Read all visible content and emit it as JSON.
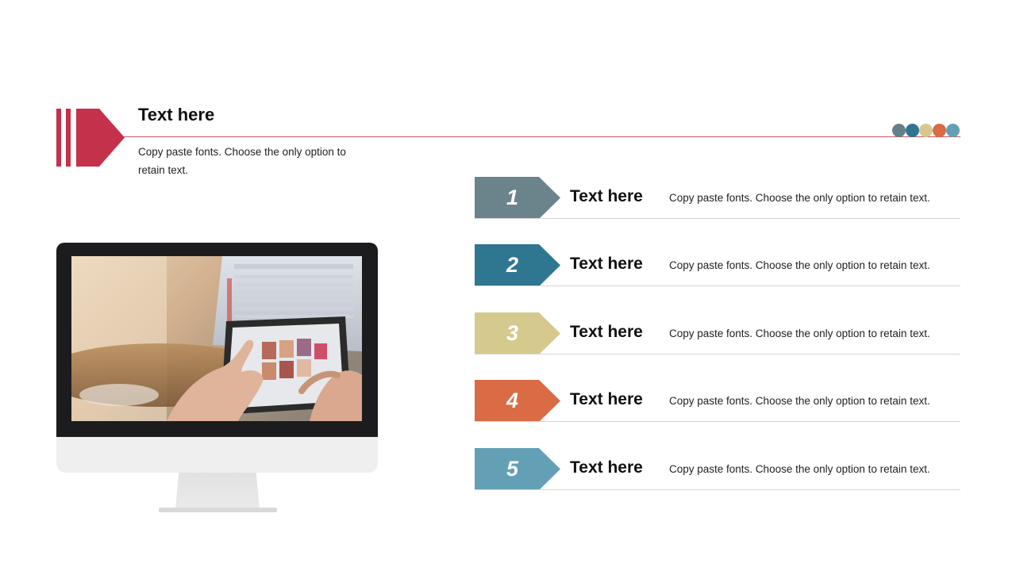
{
  "header": {
    "title": "Text here",
    "description": "Copy paste fonts. Choose the only option to retain text.",
    "accent_color": "#c4314b",
    "icon": "chevron-bars-icon"
  },
  "palette": [
    "#647f87",
    "#2f7690",
    "#d7c98d",
    "#d96b45",
    "#64a0b5"
  ],
  "monitor": {
    "image": "hands-using-tablet-photo"
  },
  "steps": [
    {
      "number": "1",
      "title": "Text here",
      "description": "Copy paste fonts. Choose the only option to retain text.",
      "color": "#6b848c"
    },
    {
      "number": "2",
      "title": "Text here",
      "description": "Copy paste fonts. Choose the only option to retain text.",
      "color": "#2f7690"
    },
    {
      "number": "3",
      "title": "Text here",
      "description": "Copy paste fonts. Choose the only option to retain text.",
      "color": "#d6c98e"
    },
    {
      "number": "4",
      "title": "Text here",
      "description": "Copy paste fonts. Choose the only option to retain text.",
      "color": "#d96b45"
    },
    {
      "number": "5",
      "title": "Text here",
      "description": "Copy paste fonts. Choose the only option to retain text.",
      "color": "#64a0b5"
    }
  ]
}
